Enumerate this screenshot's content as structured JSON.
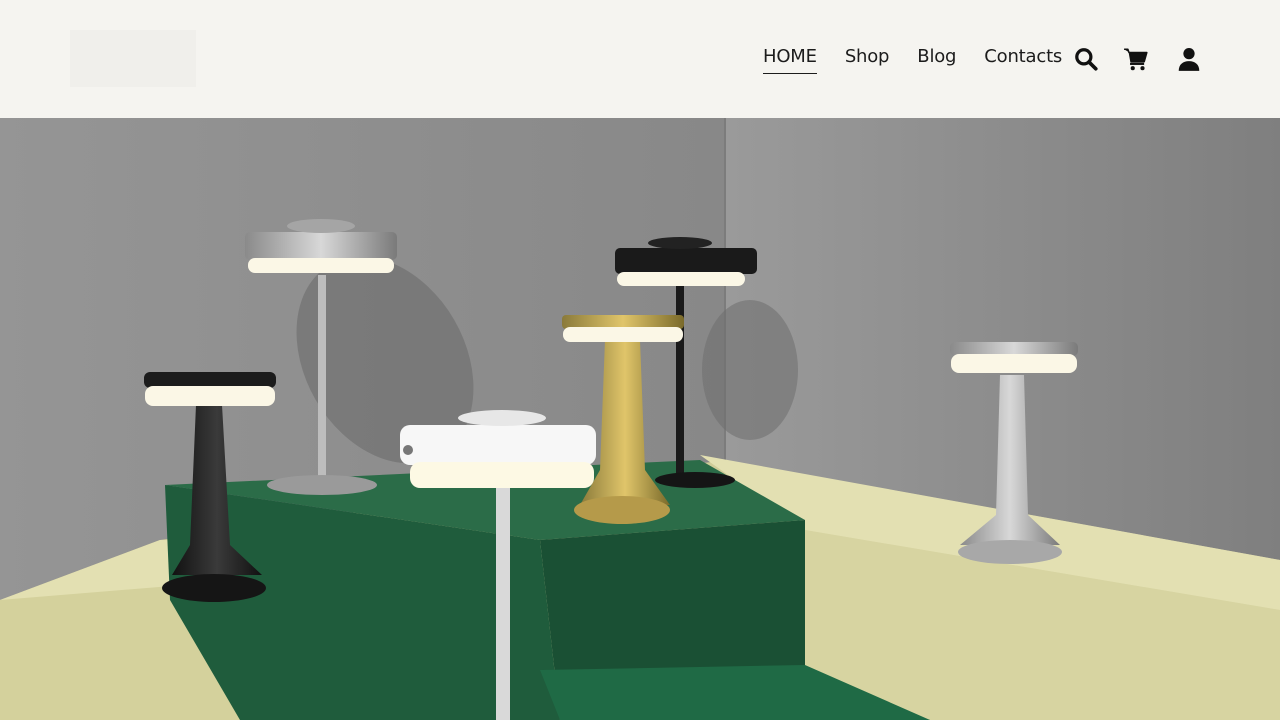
{
  "header": {
    "nav": [
      {
        "label": "HOME",
        "active": true
      },
      {
        "label": "Shop",
        "active": false
      },
      {
        "label": "Blog",
        "active": false
      },
      {
        "label": "Contacts",
        "active": false
      }
    ],
    "icons": [
      "search-icon",
      "cart-icon",
      "user-icon"
    ]
  },
  "hero": {
    "image": "product-lamps-showcase"
  },
  "colors": {
    "header_bg": "#f5f4f0",
    "text": "#1c1c1c",
    "wall": "#8c8c8c",
    "platform_yellow": "#d9d6a3",
    "platform_green": "#1f5c3c"
  }
}
